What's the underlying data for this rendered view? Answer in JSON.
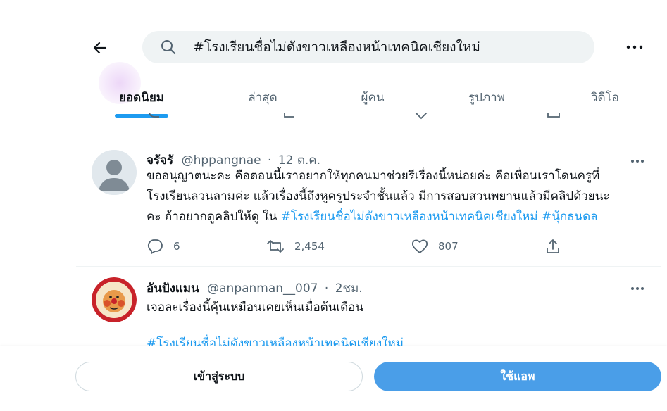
{
  "search": {
    "query": "#โรงเรียนชื่อไม่ดังขาวเหลืองหน้าเทคนิคเชียงใหม่"
  },
  "tabs": [
    {
      "label": "ยอดนิยม",
      "active": true
    },
    {
      "label": "ล่าสุด",
      "active": false
    },
    {
      "label": "ผู้คน",
      "active": false
    },
    {
      "label": "รูปภาพ",
      "active": false
    },
    {
      "label": "วิดีโอ",
      "active": false
    }
  ],
  "tweets": [
    {
      "name": "จรัจรั",
      "handle": "@hppangnae",
      "time": "12 ต.ค.",
      "text_lines": [
        "ขออนุญาตนะคะ คือตอนนี้เราอยากให้ทุกคนมาช่วยรีเรื่องนี้หน่อยค่ะ คือเพื่อนเราโดนครูที่",
        "โรงเรียนลวนลามค่ะ แล้วเรื่องนี้ถึงหูครูประจำชั้นแล้ว มีการสอบสวนพยานแล้วมีคลิปด้วยนะ"
      ],
      "text_line3_prefix": "คะ ถ้าอยากดูคลิปให้ดู ใน ",
      "hashtag1": "#โรงเรียนชื่อไม่ดังขาวเหลืองหน้าเทคนิคเชียงใหม่",
      "hashtag2": "#นุ้กธนดล",
      "replies": "6",
      "retweets": "2,454",
      "likes": "807"
    },
    {
      "name": "อันปังแมน",
      "handle": "@anpanman__007",
      "time": "2ชม.",
      "text": "เจอละเรื่องนี้คุ้นเหมือนเคยเห็นเมื่อต้นเดือน",
      "hashtag": "#โรงเรียนชื่อไม่ดังขาวเหลืองหน้าเทคนิคเชียงใหม่"
    }
  ],
  "bottom": {
    "login_label": "เข้าสู่ระบบ",
    "app_label": "ใช้แอพ"
  },
  "colors": {
    "accent": "#1d9bf0",
    "app_button": "#4a9ee8",
    "muted": "#536471"
  },
  "icons": [
    "back-arrow-icon",
    "search-icon",
    "more-icon",
    "reply-icon",
    "retweet-icon",
    "like-icon",
    "share-icon"
  ]
}
